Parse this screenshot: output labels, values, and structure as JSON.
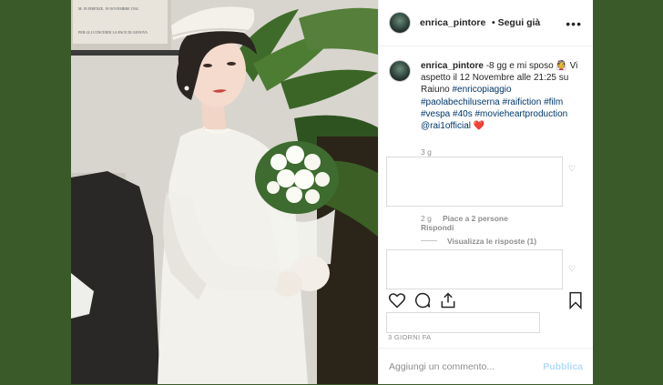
{
  "post": {
    "username": "enrica_pintore",
    "follow": "• Segui già",
    "caption_text": "-8 gg e mi sposo 👰 Vi aspetto il 12 Novembre alle 21:25 su Raiuno",
    "hashtags": "#enricopiaggio #paolabechiluserna #raifiction #film #vespa #40s #movieheartproduction @rai1official",
    "caption_heart": "❤️",
    "caption_age": "3 g",
    "comment_age": "2 g",
    "comment_likes": "Piace a 2 persone",
    "reply": "Rispondi",
    "view_replies": "Visualizza le risposte (1)",
    "date": "3 GIORNI FA",
    "add_comment_placeholder": "Aggiungi un commento...",
    "publish": "Pubblica"
  },
  "photo": {
    "plaque_line1": "M. IN FIRENZE, 19 NOVEMBRE 1934",
    "plaque_line2": "PER GLI CONCERNI LA PACE DI GENOVA"
  }
}
